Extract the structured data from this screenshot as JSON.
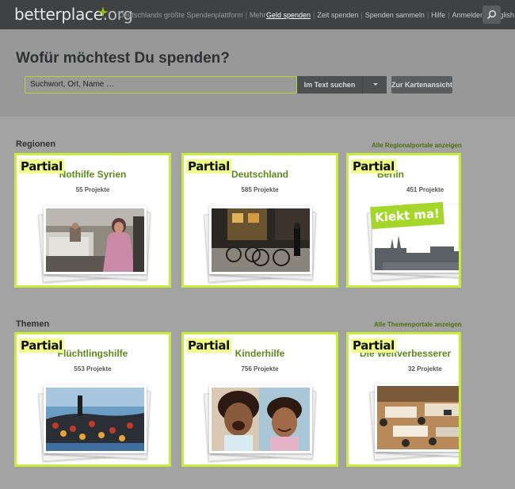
{
  "header": {
    "logo_main": "betterplace",
    "logo_tld": ".org",
    "tagline": "Deutschlands größte Spendenplattform",
    "tagline_more": "Mehr",
    "nav": [
      "Geld spenden",
      "Zeit spenden",
      "Spenden sammeln",
      "Hilfe",
      "Anmelden",
      "English"
    ],
    "nav_active_index": 0,
    "search_icon": "search-icon"
  },
  "hero": {
    "title": "Wofür möchtest Du spenden?",
    "search": {
      "value": "Suchwort, Ort, Name …",
      "placeholder": "Suchwort, Ort, Name …"
    },
    "scope_label": "Im Text suchen",
    "map_button": "Zur Kartenansicht"
  },
  "regions": {
    "title": "Regionen",
    "all_link": "Alle Regionalportale anzeigen",
    "cards": [
      {
        "title": "Nothilfe Syrien",
        "count": "55 Projekte",
        "overlay": "Partial"
      },
      {
        "title": "Deutschland",
        "count": "585 Projekte",
        "overlay": "Partial"
      },
      {
        "title": "Berlin",
        "count": "451 Projekte",
        "overlay": "Partial",
        "sign": "Kiekt ma!"
      }
    ]
  },
  "themes": {
    "title": "Themen",
    "all_link": "Alle Themenportale anzeigen",
    "cards": [
      {
        "title": "Flüchtlingshilfe",
        "count": "553 Projekte",
        "overlay": "Partial"
      },
      {
        "title": "Kinderhilfe",
        "count": "756 Projekte",
        "overlay": "Partial"
      },
      {
        "title": "Die Weltverbesserer",
        "count": "32 Projekte",
        "overlay": "Partial"
      }
    ]
  },
  "colors": {
    "accent_green": "#5b8a1a",
    "highlight_border": "#c8ec3c",
    "topbar": "#3f4143"
  }
}
